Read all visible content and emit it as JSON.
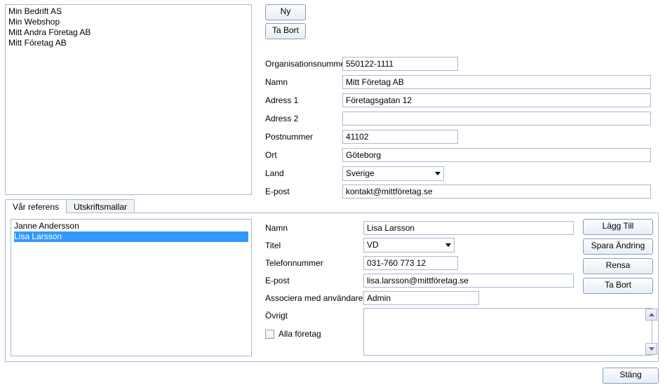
{
  "buttons": {
    "ny": "Ny",
    "ta_bort": "Ta Bort",
    "close": "Stäng"
  },
  "company_list": [
    "Min Bedrift AS",
    "Min Webshop",
    "Mitt Andra Företag AB",
    "Mitt Företag AB"
  ],
  "company_selected_index": null,
  "form": {
    "labels": {
      "orgnr": "Organisationsnummer",
      "namn": "Namn",
      "adress1": "Adress 1",
      "adress2": "Adress 2",
      "postnummer": "Postnummer",
      "ort": "Ort",
      "land": "Land",
      "epost": "E-post"
    },
    "values": {
      "orgnr": "550122-1111",
      "namn": "Mitt Företag AB",
      "adress1": "Företagsgatan 12",
      "adress2": "",
      "postnummer": "41102",
      "ort": "Göteborg",
      "land": "Sverige",
      "epost": "kontakt@mittföretag.se"
    }
  },
  "tabs": {
    "var_referens": "Vår referens",
    "utskriftsmallar": "Utskriftsmallar",
    "active": "var_referens"
  },
  "ref_list": [
    "Janne Andersson",
    "Lisa Larsson"
  ],
  "ref_selected_index": 1,
  "ref_form": {
    "labels": {
      "namn": "Namn",
      "titel": "Titel",
      "telefon": "Telefonnummer",
      "epost": "E-post",
      "associera": "Associera med användare",
      "ovrigt": "Övrigt",
      "alla_foretag": "Alla företag"
    },
    "values": {
      "namn": "Lisa Larsson",
      "titel": "VD",
      "telefon": "031-760 773 12",
      "epost": "lisa.larsson@mittföretag.se",
      "associera": "Admin",
      "ovrigt": "",
      "alla_foretag": false
    }
  },
  "ref_buttons": {
    "lagg_till": "Lägg Till",
    "spara_andring": "Spara Ändring",
    "rensa": "Rensa",
    "ta_bort": "Ta Bort"
  }
}
